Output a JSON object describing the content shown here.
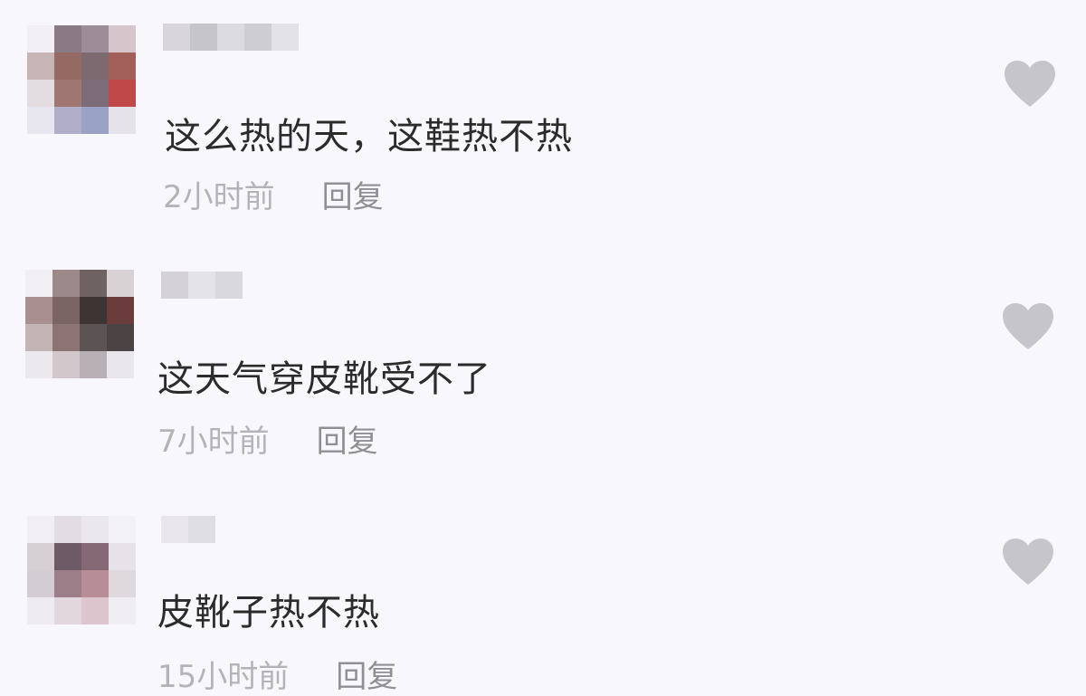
{
  "comments": [
    {
      "text": "这么热的天，这鞋热不热",
      "time": "2小时前",
      "reply": "回复",
      "like_icon": "heart-icon",
      "avatar_colors": [
        "#f2f0f5",
        "#8a7a86",
        "#9d8d99",
        "#d6c6cc",
        "#c7b4b4",
        "#946a63",
        "#7d6a70",
        "#a35f5a",
        "#e3dce0",
        "#a07672",
        "#7c6c7a",
        "#c04848",
        "#e8e6ee",
        "#b1aec7",
        "#9aa2c6",
        "#e5e2e9"
      ],
      "username_colors": [
        "#d8d6dc",
        "#c7c5cc",
        "#dcdbe0",
        "#cfcdd4",
        "#e3e2e7"
      ]
    },
    {
      "text": "这天气穿皮靴受不了",
      "time": "7小时前",
      "reply": "回复",
      "like_icon": "heart-icon",
      "avatar_colors": [
        "#f1eff4",
        "#9c8a8a",
        "#6f6262",
        "#d9d2d5",
        "#a89090",
        "#7a6464",
        "#3f3434",
        "#6a3c3c",
        "#c3b4b6",
        "#8c7474",
        "#5c5454",
        "#4c4444",
        "#ece9ee",
        "#d2c8cb",
        "#b9b0b6",
        "#e9e7ec"
      ],
      "username_colors": [
        "#d4d2d8",
        "#e4e3e8",
        "#d9d8de"
      ]
    },
    {
      "text": "皮靴子热不热",
      "time": "15小时前",
      "reply": "回复",
      "like_icon": "heart-icon",
      "avatar_colors": [
        "#f1eff4",
        "#e2dde2",
        "#ebe8ed",
        "#f3f2f6",
        "#d6d0d5",
        "#6d5a64",
        "#846873",
        "#e6e2e8",
        "#d3ccd2",
        "#9d7f8a",
        "#b78e98",
        "#dfd8dd",
        "#eeecf0",
        "#e1d7dc",
        "#dcc5cc",
        "#f0eef2"
      ],
      "username_colors": [
        "#e8e6ec",
        "#dedde3"
      ]
    }
  ],
  "colors": {
    "background": "#f8f8fc",
    "text": "#2b2b2b",
    "meta": "#b3b3b8",
    "reply": "#8f8f96",
    "heart": "#c6c6ca"
  }
}
